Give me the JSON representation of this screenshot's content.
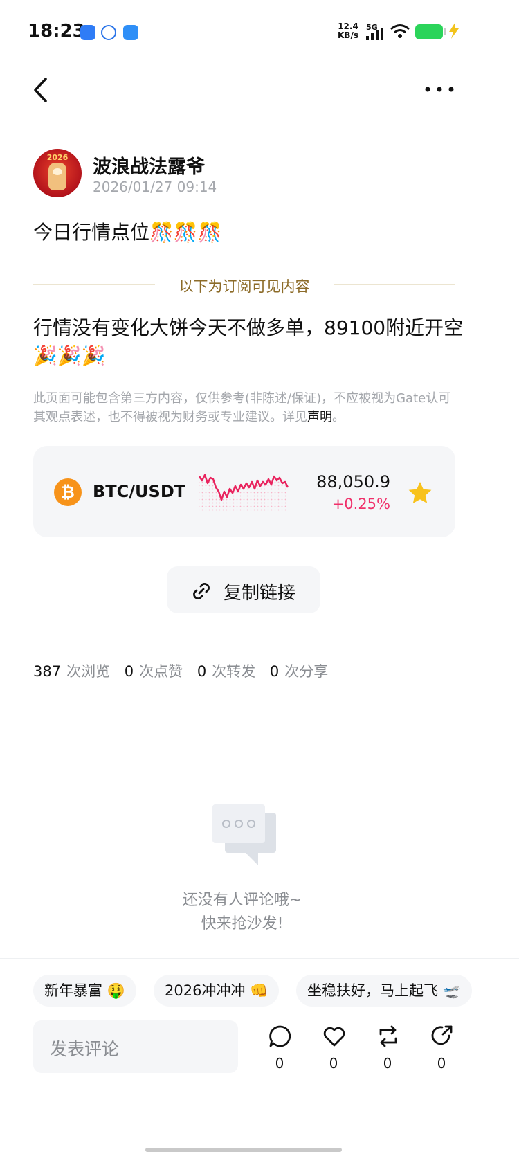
{
  "status_bar": {
    "time": "18:23",
    "net_speed_value": "12.4",
    "net_speed_unit": "KB/s",
    "network": "5G",
    "icons": [
      "app-icon-1",
      "app-icon-2",
      "app-icon-3",
      "signal-icon",
      "wifi-icon",
      "battery-icon",
      "charging-icon"
    ]
  },
  "nav": {
    "back_icon": "chevron-left-icon",
    "more_icon": "more-icon"
  },
  "post": {
    "author": "波浪战法露爷",
    "avatar_text": "2026",
    "timestamp": "2026/01/27 09:14",
    "title": "今日行情点位🎊🎊🎊",
    "subscription_divider": "以下为订阅可见内容",
    "body": "行情没有变化大饼今天不做多单，89100附近开空🎉🎉🎉",
    "disclaimer": "此页面可能包含第三方内容，仅供参考(非陈述/保证)，不应被视为Gate认可其观点表述，也不得被视为财务或专业建议。详见",
    "disclaimer_link": "声明",
    "disclaimer_end": "。"
  },
  "ticker": {
    "symbol_icon": "bitcoin-icon",
    "symbol_glyph": "₿",
    "pair": "BTC/USDT",
    "price": "88,050.9",
    "change": "+0.25%",
    "accent": "#f0306a",
    "favorite_icon": "star-icon",
    "star_color": "#f8c21c"
  },
  "copy_link": {
    "label": "复制链接",
    "icon": "link-icon"
  },
  "stats": [
    {
      "value": "387",
      "label": "次浏览"
    },
    {
      "value": "0",
      "label": "次点赞"
    },
    {
      "value": "0",
      "label": "次转发"
    },
    {
      "value": "0",
      "label": "次分享"
    }
  ],
  "empty_comments": {
    "line1": "还没有人评论哦~",
    "line2": "快来抢沙发!"
  },
  "quick_replies": [
    "新年暴富 🤑",
    "2026冲冲冲 👊",
    "坐稳扶好，马上起飞 🛫"
  ],
  "comment_bar": {
    "placeholder": "发表评论",
    "actions": [
      {
        "icon": "comment-icon",
        "count": "0"
      },
      {
        "icon": "heart-icon",
        "count": "0"
      },
      {
        "icon": "repost-icon",
        "count": "0"
      },
      {
        "icon": "share-icon",
        "count": "0"
      }
    ]
  }
}
